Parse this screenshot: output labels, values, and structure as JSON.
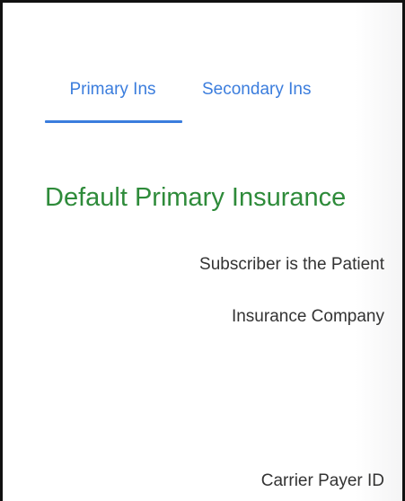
{
  "tabs": [
    {
      "label": "Primary Ins",
      "active": true
    },
    {
      "label": "Secondary Ins",
      "active": false
    }
  ],
  "section": {
    "title": "Default Primary Insurance"
  },
  "fields": {
    "subscriber_label": "Subscriber is the Patient",
    "company_label": "Insurance Company",
    "payer_id_label": "Carrier Payer ID"
  },
  "colors": {
    "tab_text": "#3b7ddd",
    "section_title": "#2e8b3a",
    "label_text": "#333333"
  }
}
